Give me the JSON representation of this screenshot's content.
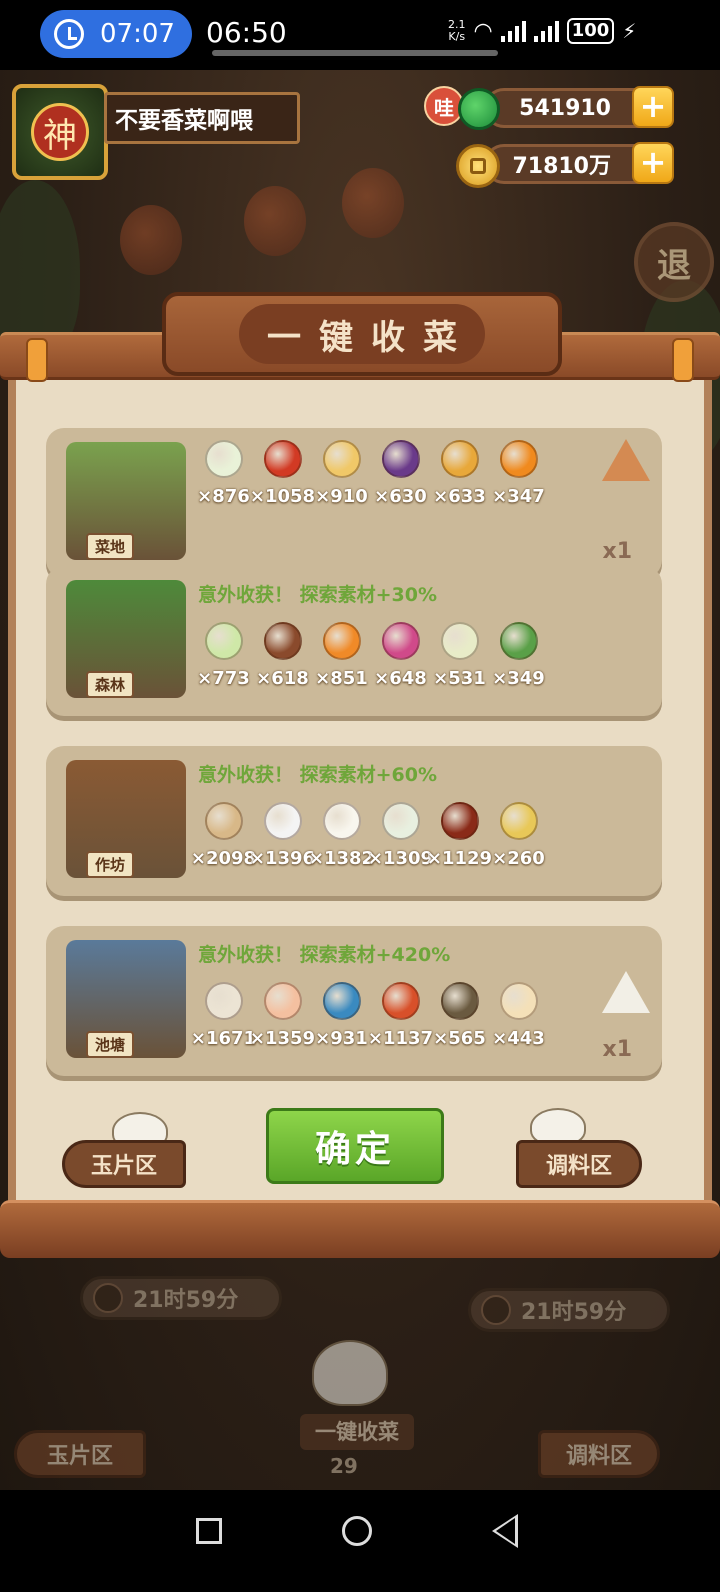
{
  "status_bar": {
    "clock_pill": "07:07",
    "time": "06:50",
    "net_speed_value": "2.1",
    "net_speed_unit": "K/s",
    "battery": "100"
  },
  "header": {
    "avatar_glyph": "神",
    "player_name": "不要香菜啊喂",
    "wa_badge": "哇",
    "jade_amount": "541910",
    "coin_amount": "71810万",
    "plus_symbol": "+",
    "exit_glyph": "退"
  },
  "dialog": {
    "title": "一键收菜",
    "cards": [
      {
        "place": "菜地",
        "bonus": "",
        "thumb_color": "#7aa24e",
        "multiplier": "x1",
        "badge": "orange-triangle-token-icon",
        "items": [
          {
            "icon": "scallion-icon",
            "color": "#e9f2d8",
            "count": "×876"
          },
          {
            "icon": "chili-pepper-icon",
            "color": "#d23a24",
            "count": "×1058"
          },
          {
            "icon": "potato-icon",
            "color": "#f0c868",
            "count": "×910"
          },
          {
            "icon": "eggplant-icon",
            "color": "#6a3a8a",
            "count": "×630"
          },
          {
            "icon": "pineapple-icon",
            "color": "#e8a83a",
            "count": "×633"
          },
          {
            "icon": "pumpkin-icon",
            "color": "#f08a1e",
            "count": "×347"
          }
        ]
      },
      {
        "place": "森林",
        "bonus": "意外收获！ 探索素材+30%",
        "thumb_color": "#4e8a3a",
        "multiplier": "",
        "badge": "",
        "items": [
          {
            "icon": "cabbage-icon",
            "color": "#cfe8a8",
            "count": "×773"
          },
          {
            "icon": "mushroom-icon",
            "color": "#8a4a2c",
            "count": "×618"
          },
          {
            "icon": "carrot-icon",
            "color": "#f08a28",
            "count": "×851"
          },
          {
            "icon": "radish-icon",
            "color": "#d04a8a",
            "count": "×648"
          },
          {
            "icon": "bamboo-shoot-icon",
            "color": "#e8ecc8",
            "count": "×531"
          },
          {
            "icon": "herb-leaf-icon",
            "color": "#5aa048",
            "count": "×349"
          }
        ]
      },
      {
        "place": "作坊",
        "bonus": "意外收获！ 探索素材+60%",
        "thumb_color": "#8a5a34",
        "multiplier": "",
        "badge": "",
        "items": [
          {
            "icon": "flour-sack-icon",
            "color": "#d8b888",
            "count": "×2098"
          },
          {
            "icon": "rice-bowl-icon",
            "color": "#f4f4f4",
            "count": "×1396"
          },
          {
            "icon": "tofu-icon",
            "color": "#f8f6ee",
            "count": "×1382"
          },
          {
            "icon": "sticky-rice-icon",
            "color": "#e8f0e0",
            "count": "×1309"
          },
          {
            "icon": "sauce-jar-icon",
            "color": "#8a2a18",
            "count": "×1129"
          },
          {
            "icon": "gravy-boat-icon",
            "color": "#e8c858",
            "count": "×260"
          }
        ]
      },
      {
        "place": "池塘",
        "bonus": "意外收获！ 探索素材+420%",
        "thumb_color": "#5a7a9a",
        "multiplier": "x1",
        "badge": "white-triangle-token-icon",
        "items": [
          {
            "icon": "clam-icon",
            "color": "#ece4d4",
            "count": "×1671"
          },
          {
            "icon": "shrimp-icon",
            "color": "#f4c0a0",
            "count": "×1359"
          },
          {
            "icon": "fish-icon",
            "color": "#3a8ac0",
            "count": "×931"
          },
          {
            "icon": "meat-chunk-icon",
            "color": "#d8502a",
            "count": "×1137"
          },
          {
            "icon": "crab-icon",
            "color": "#6a5a40",
            "count": "×565"
          },
          {
            "icon": "fish-fin-icon",
            "color": "#f4e0b8",
            "count": "×443"
          }
        ]
      }
    ],
    "confirm_label": "确定",
    "left_button": "玉片区",
    "right_button": "调料区"
  },
  "background_ui": {
    "timer_left": "21时59分",
    "timer_right": "21时59分",
    "left_button": "玉片区",
    "right_button": "调料区",
    "harvest_label": "一键收菜",
    "harvest_count": "29"
  },
  "colors": {
    "accent_green": "#6fa63a",
    "confirm_green": "#5aa628",
    "panel_bg": "#e9dcc4",
    "card_bg": "#cbb999"
  }
}
